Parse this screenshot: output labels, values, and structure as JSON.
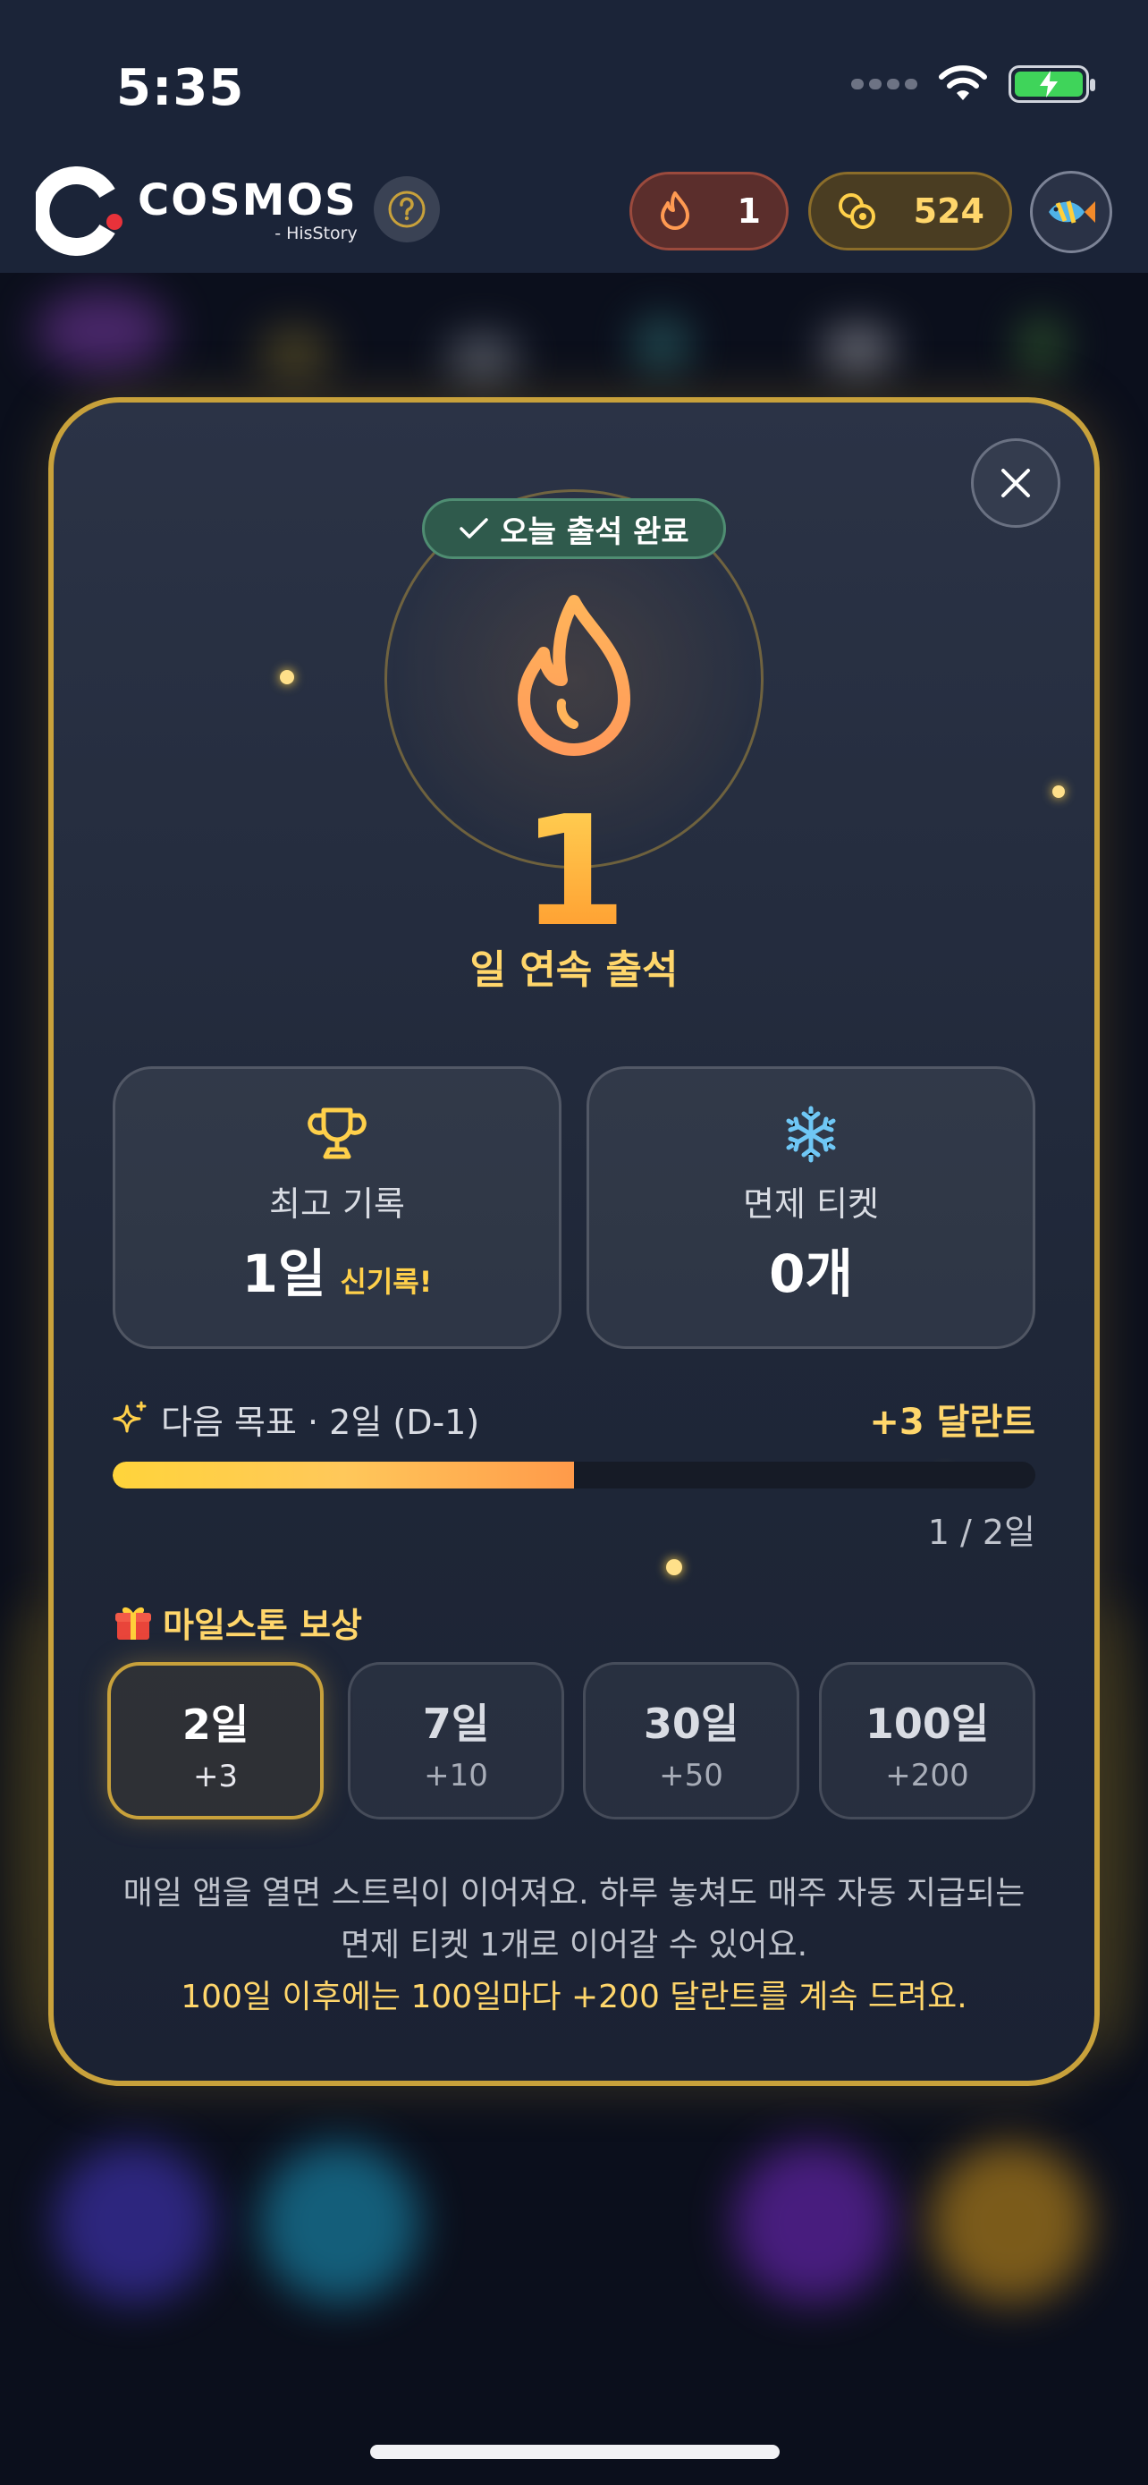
{
  "status_bar": {
    "time": "5:35"
  },
  "header": {
    "app_name": "COSMOS",
    "app_sub": "- HisStory",
    "help_icon": "question-circle-icon",
    "streak_count": "1",
    "coin_count": "524",
    "avatar_icon": "fish-icon"
  },
  "modal": {
    "badge": "오늘 출석 완료",
    "streak_number": "1",
    "streak_label": "일 연속 출석",
    "best": {
      "title": "최고 기록",
      "value": "1일",
      "tag": "신기록!"
    },
    "ticket": {
      "title": "면제 티켓",
      "value": "0개"
    },
    "goal": {
      "label": "다음 목표 · 2일 (D-1)",
      "reward": "+3 달란트",
      "progress_fraction": 0.5,
      "progress_text": "1 / 2일"
    },
    "milestone_title": "마일스톤 보상",
    "milestones": [
      {
        "day": "2일",
        "reward": "+3",
        "active": true
      },
      {
        "day": "7일",
        "reward": "+10",
        "active": false
      },
      {
        "day": "30일",
        "reward": "+50",
        "active": false
      },
      {
        "day": "100일",
        "reward": "+200",
        "active": false
      }
    ],
    "desc_line1": "매일 앱을 열면 스트릭이 이어져요. 하루 놓쳐도 매주 자동 지급되는",
    "desc_line2": "면제 티켓 1개로 이어갈 수 있어요.",
    "desc_highlight": "100일 이후에는 100일마다 +200 달란트를 계속 드려요."
  },
  "colors": {
    "gold": "#c8a13b",
    "accent": "#ffd66b",
    "flame": "#ff9a2e",
    "badge_green": "#2f5a4c"
  }
}
